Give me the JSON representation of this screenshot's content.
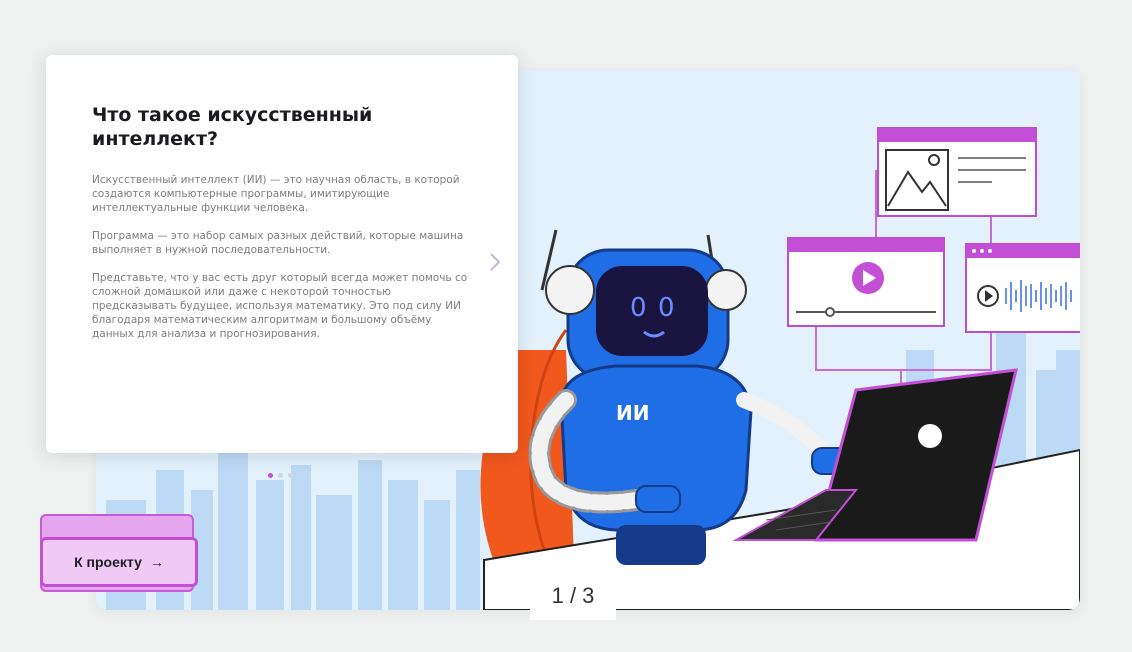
{
  "slide": {
    "title": "Что такое искусственный интеллект?",
    "paragraphs": [
      "Искусственный интеллект (ИИ) — это научная область, в которой создаются компьютерные программы, имитирующие интеллектуальные функции человека.",
      "Программа — это набор самых разных действий, которые машина выполняет в нужной последовательности.",
      "Представьте, что у вас есть друг который всегда может помочь со сложной домашкой или даже с некоторой точностью предсказывать будущее, используя математику. Это под силу ИИ благодаря математическим алгоритмам и большому объёму данных для анализа и прогнозирования."
    ],
    "dots_total": 3,
    "dots_active": 1
  },
  "robot": {
    "chest_label": "ИИ"
  },
  "project_button": {
    "label": "К проекту",
    "arrow": "→"
  },
  "counter": "1 / 3",
  "colors": {
    "accent": "#c24fd6",
    "robot_blue": "#1f6ee6",
    "chair_orange": "#f0581e",
    "sky": "#e2f1fc"
  }
}
